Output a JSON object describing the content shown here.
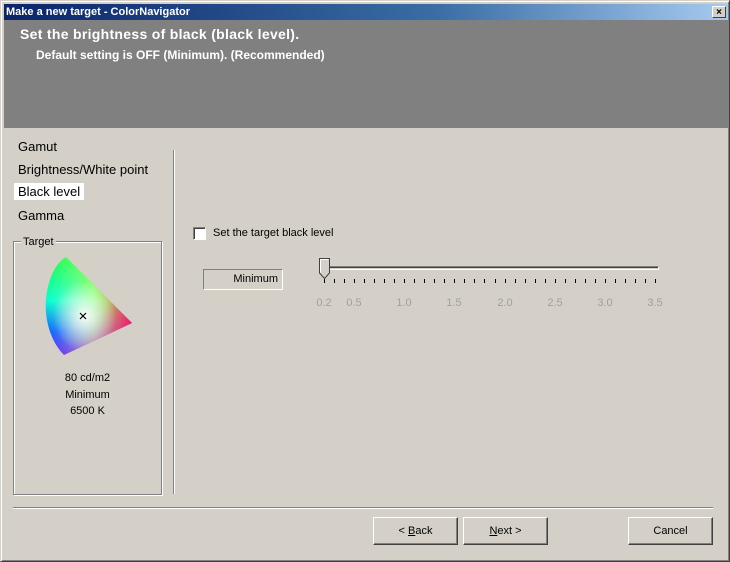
{
  "window": {
    "title": "Make a new target - ColorNavigator",
    "close_glyph": "×"
  },
  "header": {
    "title": "Set the brightness of black (black level).",
    "subtitle": "Default setting is OFF (Minimum). (Recommended)"
  },
  "nav": {
    "items": [
      {
        "label": "Gamut",
        "active": false
      },
      {
        "label": "Brightness/White point",
        "active": false
      },
      {
        "label": "Black level",
        "active": true
      },
      {
        "label": "Gamma",
        "active": false
      }
    ]
  },
  "target": {
    "legend": "Target",
    "brightness": "80 cd/m2",
    "black_level": "Minimum",
    "white_point": "6500 K",
    "marker": "×"
  },
  "black_level": {
    "checkbox_label": "Set the target black level",
    "checked": false,
    "value_display": "Minimum",
    "slider_min": 0.2,
    "slider_max": 3.5,
    "slider_value": 0.2,
    "tick_labels": [
      "0.2",
      "0.5",
      "1.0",
      "1.5",
      "2.0",
      "2.5",
      "3.0",
      "3.5"
    ]
  },
  "buttons": {
    "back_prefix": "< ",
    "back_mnemonic": "B",
    "back_rest": "ack",
    "next_mnemonic": "N",
    "next_rest": "ext >",
    "cancel": "Cancel"
  }
}
